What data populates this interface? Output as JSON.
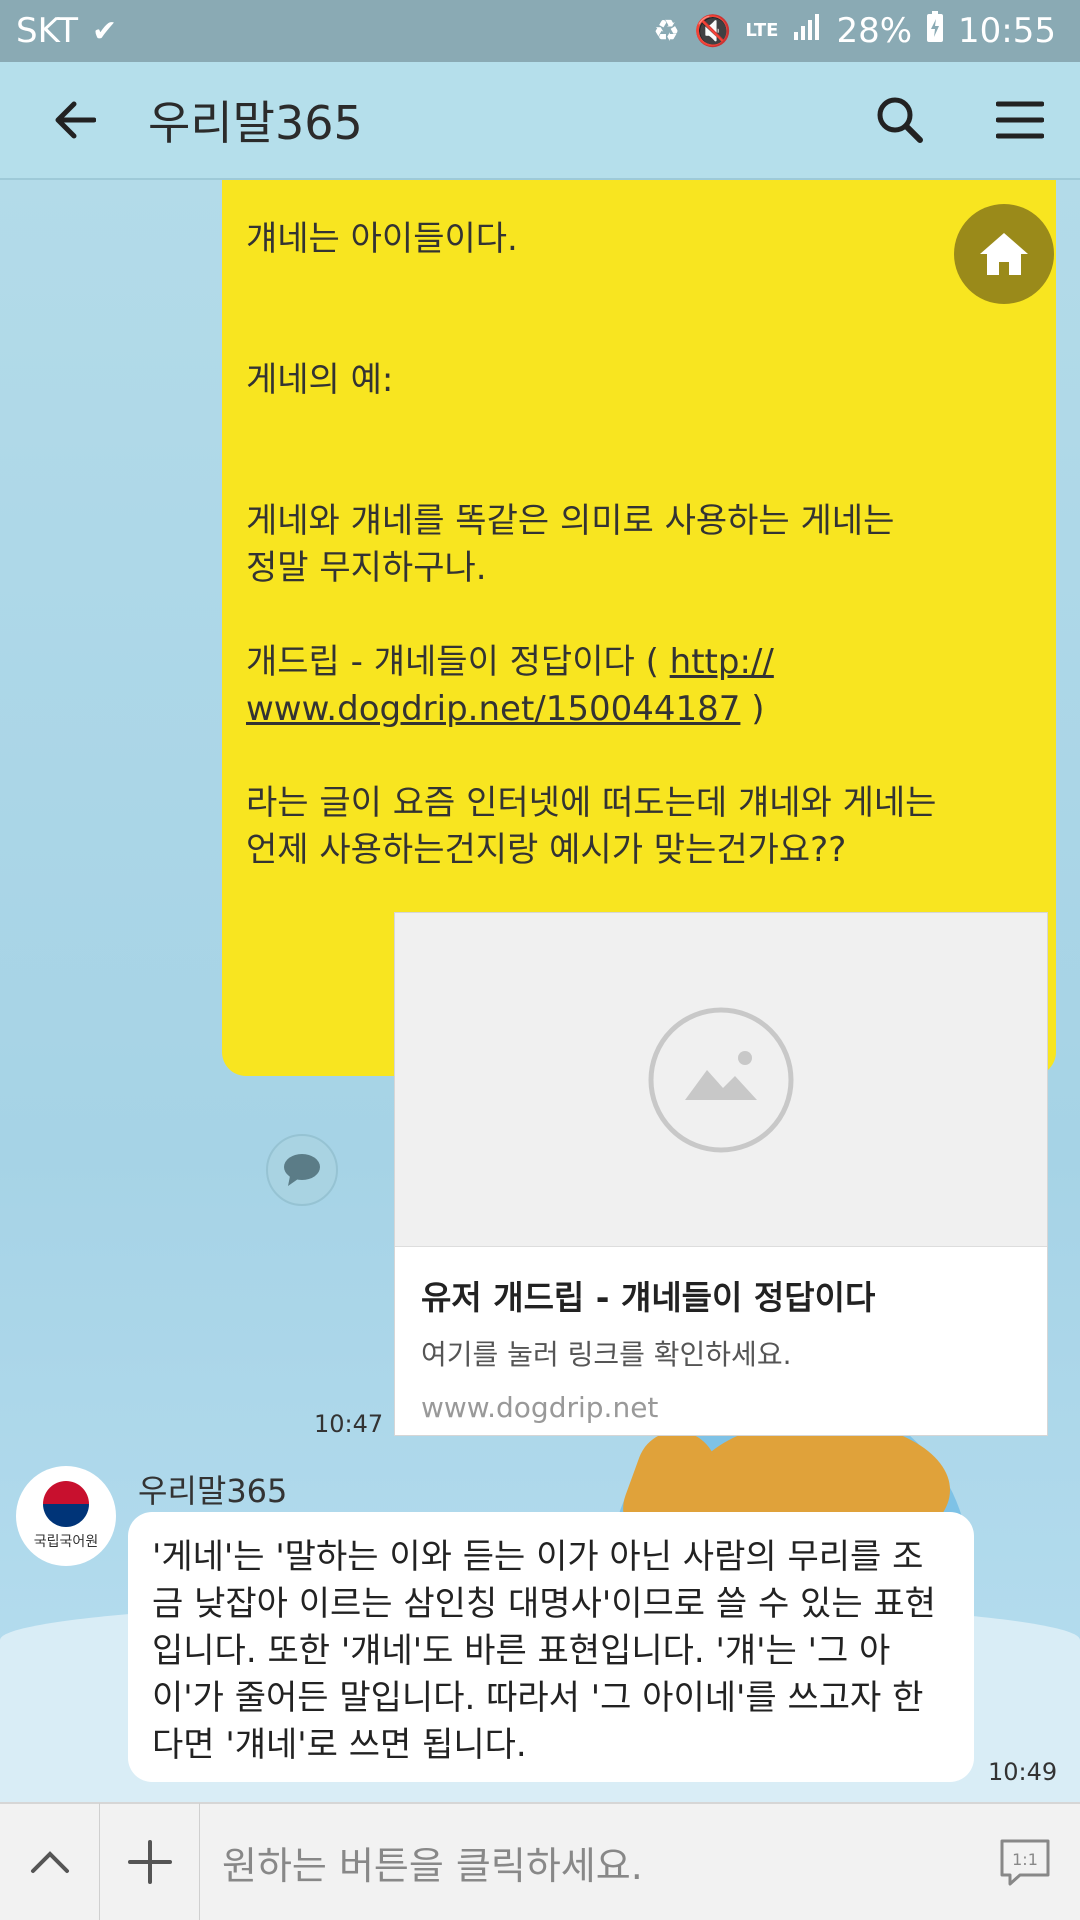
{
  "status_bar": {
    "carrier": "SKT",
    "battery": "28%",
    "time": "10:55",
    "network": "LTE"
  },
  "header": {
    "title": "우리말365",
    "icons": [
      "back-arrow-icon",
      "search-icon",
      "menu-icon"
    ]
  },
  "my_message": {
    "text": "걔네는 아이들이다.\n\n\n게네의 예:\n\n\n게네와 걔네를 똑같은 의미로 사용하는 게네는\n정말 무지하구나.\n\n개드립 - 걔네들이 정답이다 ( ",
    "link": "http://\nwww.dogdrip.net/150044187",
    "tail": " )\n\n라는 글이 요즘 인터넷에 떠도는데 걔네와 게네는\n언제 사용하는건지랑 예시가 맞는건가요??",
    "time": "10:47"
  },
  "link_preview": {
    "title": "유저 개드립 - 걔네들이 정답이다",
    "description": "여기를 눌러 링크를 확인하세요.",
    "domain": "www.dogdrip.net"
  },
  "reply": {
    "sender": "우리말365",
    "avatar_label": "국립국어원",
    "text": "'게네'는 '말하는 이와 듣는 이가 아닌 사람의 무리를 조금 낮잡아 이르는 삼인칭 대명사'이므로 쓸 수 있는 표현입니다. 또한 '걔네'도 바른 표현입니다. '걔'는 '그 아이'가 줄어든 말입니다. 따라서 '그 아이네'를 쓰고자 한다면 '걔네'로 쓰면 됩니다.",
    "time": "10:49"
  },
  "input_bar": {
    "placeholder": "원하는 버튼을 클릭하세요.",
    "right_badge": "1:1"
  },
  "colors": {
    "my_bubble": "#f8e520",
    "header_bg": "#b5dfeb",
    "status_bg": "#8aaab4",
    "home_button": "#9a8a1a"
  }
}
